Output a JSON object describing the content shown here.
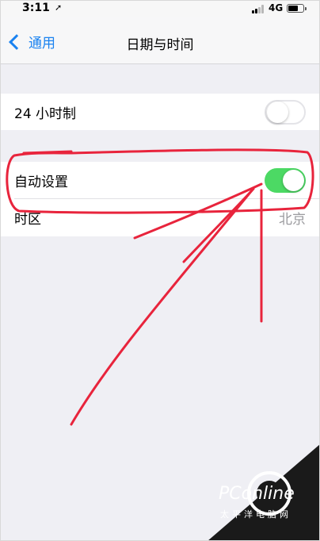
{
  "status_bar": {
    "time": "3:11",
    "network": "4G"
  },
  "nav": {
    "back_label": "通用",
    "title": "日期与时间"
  },
  "settings": {
    "hour24_label": "24 小时制",
    "hour24_on": false,
    "auto_label": "自动设置",
    "auto_on": true,
    "timezone_label": "时区",
    "timezone_value": "北京"
  },
  "colors": {
    "accent": "#1a82f0",
    "toggle_on": "#4cd964",
    "annotation": "#e8243c"
  },
  "watermark": {
    "brand": "PConline",
    "sub": "太平洋电脑网"
  }
}
